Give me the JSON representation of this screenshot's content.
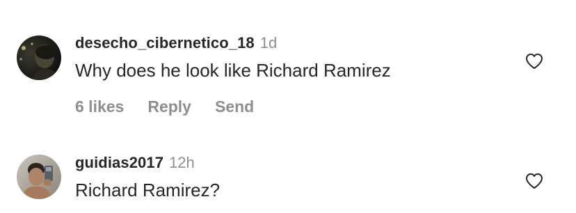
{
  "comments": [
    {
      "username": "desecho_cibernetico_18",
      "time": "1d",
      "text": "Why does he look like Richard Ramirez",
      "likes_label": "6 likes",
      "reply_label": "Reply",
      "send_label": "Send",
      "avatar_icon": "user-avatar-dark-night-photo",
      "like_icon": "heart-outline-icon"
    },
    {
      "username": "guidias2017",
      "time": "12h",
      "text": "Richard Ramirez?",
      "avatar_icon": "user-avatar-mirror-selfie-photo",
      "like_icon": "heart-outline-icon"
    }
  ],
  "colors": {
    "text_primary": "#262626",
    "text_secondary": "#8e8e8e",
    "background": "#ffffff"
  }
}
